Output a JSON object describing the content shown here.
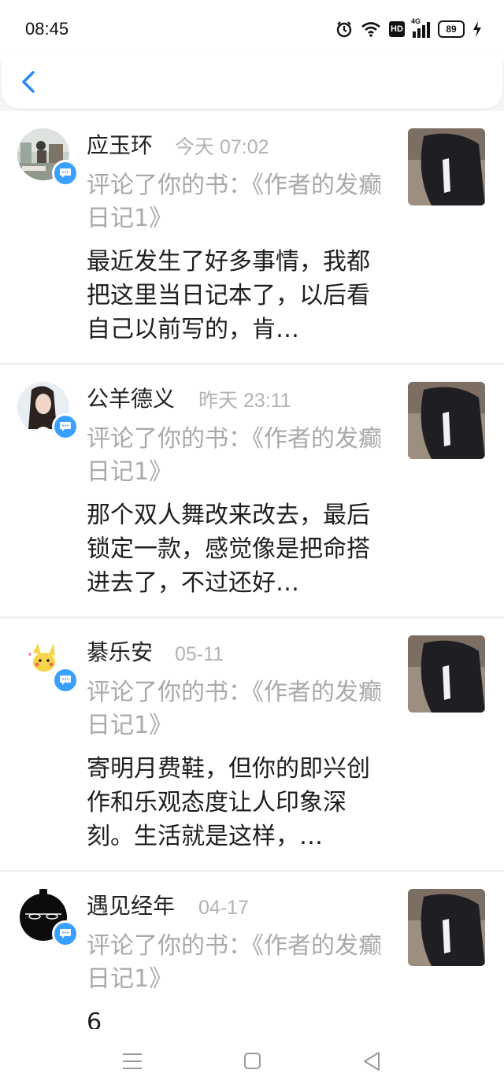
{
  "status_bar": {
    "time": "08:45",
    "battery": "89",
    "network": "4G",
    "hd": "HD",
    "icons": [
      "alarm-icon",
      "wifi-icon",
      "hd-icon",
      "signal-icon",
      "battery-icon",
      "charging-icon"
    ]
  },
  "header": {
    "back_icon": "chevron-left-icon",
    "accent_color": "#2e8cf0"
  },
  "notifications": [
    {
      "name": "应玉环",
      "time": "今天 07:02",
      "desc": "评论了你的书：《作者的发癫日记1》",
      "comment": "最近发生了好多事情，我都把这里当日记本了，以后看自己以前写的，肯…"
    },
    {
      "name": "公羊德义",
      "time": "昨天 23:11",
      "desc": "评论了你的书：《作者的发癫日记1》",
      "comment": "那个双人舞改来改去，最后锁定一款，感觉像是把命搭进去了，不过还好…"
    },
    {
      "name": "綦乐安",
      "time": "05-11",
      "desc": "评论了你的书：《作者的发癫日记1》",
      "comment": "寄明月费鞋，但你的即兴创作和乐观态度让人印象深刻。生活就是这样，…"
    },
    {
      "name": "遇见经年",
      "time": "04-17",
      "desc": "评论了你的书：《作者的发癫日记1》",
      "comment": "6"
    }
  ],
  "badge_color": "#3aa0ff",
  "nav": {
    "icons": [
      "menu-icon",
      "home-square-icon",
      "back-triangle-icon"
    ]
  }
}
